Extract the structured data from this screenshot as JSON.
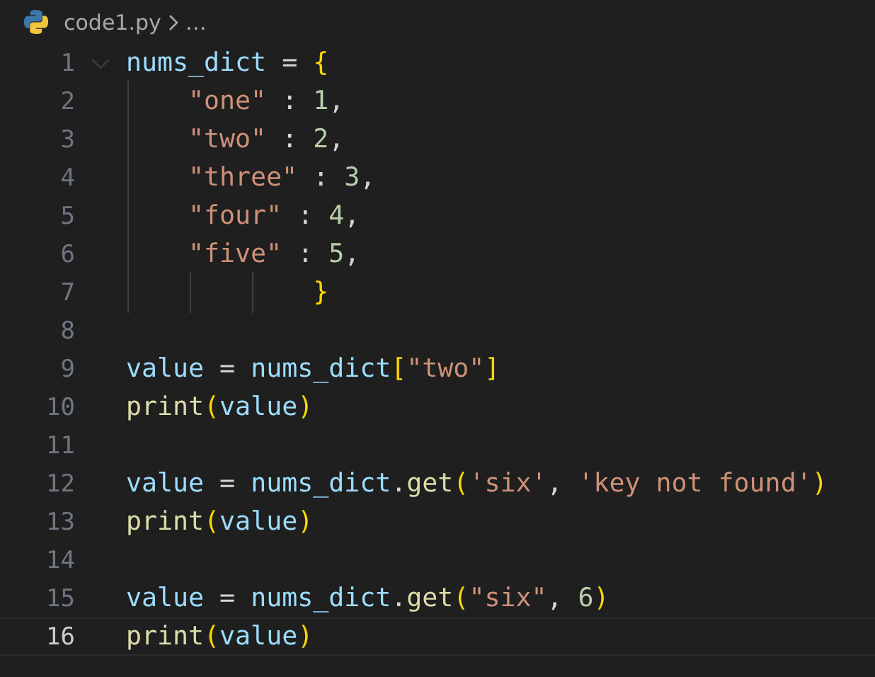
{
  "breadcrumb": {
    "file": "code1.py",
    "more": "…"
  },
  "lines": [
    {
      "number": "1",
      "selected": false,
      "expanded": true,
      "tokens": [
        {
          "kind": "var",
          "t": "nums_dict"
        },
        {
          "kind": "op",
          "t": " = "
        },
        {
          "kind": "bracket",
          "t": "{"
        }
      ]
    },
    {
      "number": "2",
      "selected": false,
      "tokens": [
        {
          "kind": "str",
          "t": "    \"one\""
        },
        {
          "kind": "op",
          "t": " : "
        },
        {
          "kind": "num",
          "t": "1"
        },
        {
          "kind": "op",
          "t": ","
        }
      ]
    },
    {
      "number": "3",
      "selected": false,
      "tokens": [
        {
          "kind": "str",
          "t": "    \"two\""
        },
        {
          "kind": "op",
          "t": " : "
        },
        {
          "kind": "num",
          "t": "2"
        },
        {
          "kind": "op",
          "t": ","
        }
      ]
    },
    {
      "number": "4",
      "selected": false,
      "tokens": [
        {
          "kind": "str",
          "t": "    \"three\""
        },
        {
          "kind": "op",
          "t": " : "
        },
        {
          "kind": "num",
          "t": "3"
        },
        {
          "kind": "op",
          "t": ","
        }
      ]
    },
    {
      "number": "5",
      "selected": false,
      "tokens": [
        {
          "kind": "str",
          "t": "    \"four\""
        },
        {
          "kind": "op",
          "t": " : "
        },
        {
          "kind": "num",
          "t": "4"
        },
        {
          "kind": "op",
          "t": ","
        }
      ]
    },
    {
      "number": "6",
      "selected": false,
      "tokens": [
        {
          "kind": "str",
          "t": "    \"five\""
        },
        {
          "kind": "op",
          "t": " : "
        },
        {
          "kind": "num",
          "t": "5"
        },
        {
          "kind": "op",
          "t": ","
        }
      ]
    },
    {
      "number": "7",
      "selected": false,
      "tokens": [
        {
          "kind": "bracket",
          "t": "            }"
        }
      ]
    },
    {
      "number": "8",
      "selected": false
    },
    {
      "number": "9",
      "selected": false,
      "tokens": [
        {
          "kind": "var",
          "t": "value"
        },
        {
          "kind": "op",
          "t": " = "
        },
        {
          "kind": "var",
          "t": "nums_dict"
        },
        {
          "kind": "bracket",
          "t": "["
        },
        {
          "kind": "str",
          "t": "\"two\""
        },
        {
          "kind": "bracket",
          "t": "]"
        }
      ]
    },
    {
      "number": "10",
      "selected": false,
      "tokens": [
        {
          "kind": "func",
          "t": "print"
        },
        {
          "kind": "bracket",
          "t": "("
        },
        {
          "kind": "var",
          "t": "value"
        },
        {
          "kind": "bracket",
          "t": ")"
        }
      ]
    },
    {
      "number": "11",
      "selected": false
    },
    {
      "number": "12",
      "selected": false,
      "tokens": [
        {
          "kind": "var",
          "t": "value"
        },
        {
          "kind": "op",
          "t": " = "
        },
        {
          "kind": "var",
          "t": "nums_dict"
        },
        {
          "kind": "op",
          "t": "."
        },
        {
          "kind": "func",
          "t": "get"
        },
        {
          "kind": "bracket",
          "t": "("
        },
        {
          "kind": "str",
          "t": "'six'"
        },
        {
          "kind": "op",
          "t": ", "
        },
        {
          "kind": "str",
          "t": "'key not found'"
        },
        {
          "kind": "bracket",
          "t": ")"
        }
      ]
    },
    {
      "number": "13",
      "selected": false,
      "tokens": [
        {
          "kind": "func",
          "t": "print"
        },
        {
          "kind": "bracket",
          "t": "("
        },
        {
          "kind": "var",
          "t": "value"
        },
        {
          "kind": "bracket",
          "t": ")"
        }
      ]
    },
    {
      "number": "14",
      "selected": false
    },
    {
      "number": "15",
      "selected": false,
      "tokens": [
        {
          "kind": "var",
          "t": "value"
        },
        {
          "kind": "op",
          "t": " = "
        },
        {
          "kind": "var",
          "t": "nums_dict"
        },
        {
          "kind": "op",
          "t": "."
        },
        {
          "kind": "func",
          "t": "get"
        },
        {
          "kind": "bracket",
          "t": "("
        },
        {
          "kind": "str",
          "t": "\"six\""
        },
        {
          "kind": "op",
          "t": ", "
        },
        {
          "kind": "num",
          "t": "6"
        },
        {
          "kind": "bracket",
          "t": ")"
        }
      ]
    },
    {
      "number": "16",
      "selected": true,
      "tokens": [
        {
          "kind": "func",
          "t": "print"
        },
        {
          "kind": "bracket",
          "t": "("
        },
        {
          "kind": "var",
          "t": "value"
        },
        {
          "kind": "bracket",
          "t": ")"
        }
      ]
    }
  ]
}
